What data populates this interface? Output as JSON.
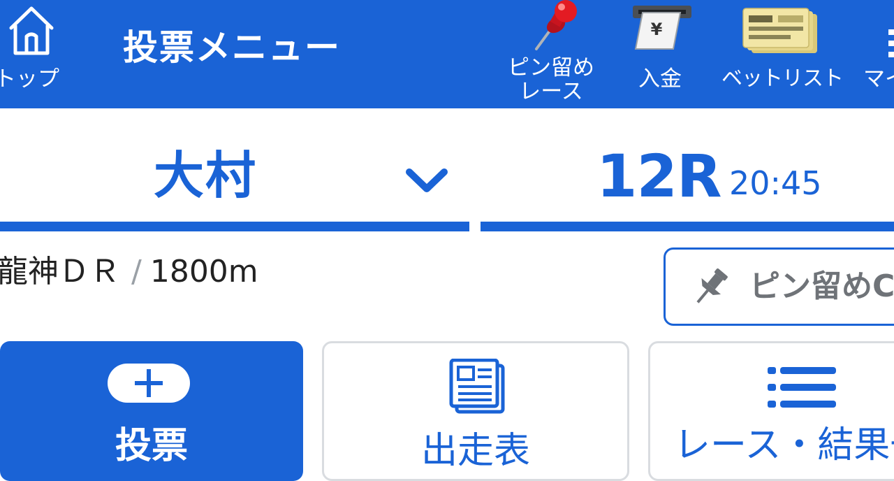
{
  "header": {
    "title": "投票メニュー",
    "home_label": "トップ",
    "pinned_races_label_line1": "ピン留め",
    "pinned_races_label_line2": "レース",
    "deposit_label": "入金",
    "deposit_icon_symbol": "¥",
    "bet_list_label": "ベットリスト",
    "my_menu_label": "マイ",
    "background_color": "#1a63d6"
  },
  "race_selector": {
    "venue": "大村",
    "race_number": "12R",
    "post_time": "20:45"
  },
  "race_info": {
    "race_name": "龍神ＤＲ",
    "separator": "/",
    "distance": "1800m",
    "pin_button_label": "ピン留めC"
  },
  "actions": {
    "bet_label": "投票",
    "entry_table_label": "出走表",
    "results_label": "レース・結果一"
  },
  "colors": {
    "accent": "#1a63d6",
    "card_border": "#d9dce0",
    "muted_text": "#6f7378"
  }
}
